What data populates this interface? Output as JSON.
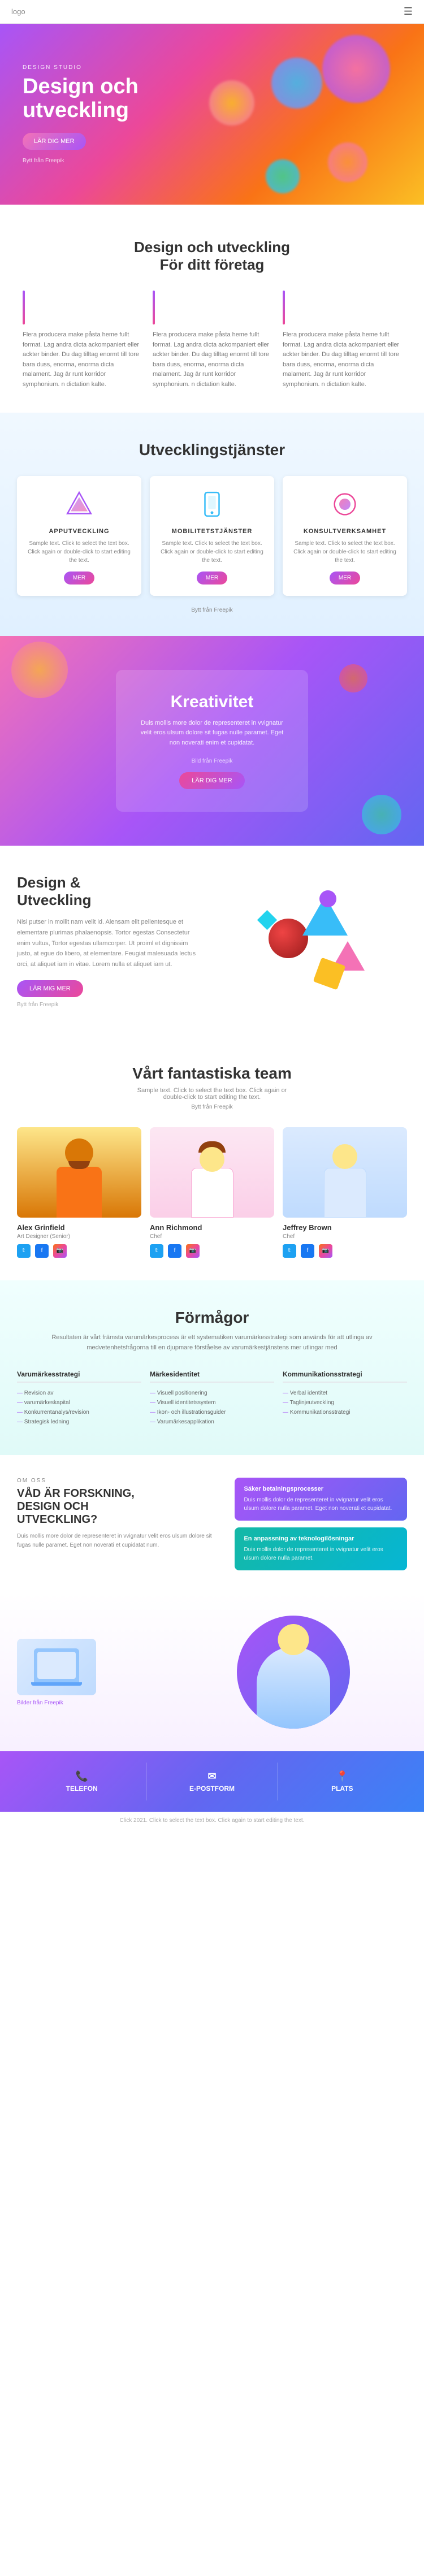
{
  "nav": {
    "logo": "logo",
    "menu_icon": "☰"
  },
  "hero": {
    "subtitle": "DESIGN STUDIO",
    "title": "Design och\nutveckling",
    "btn_label": "LÄR DIG MER",
    "link_text": "Bytt från Freepik"
  },
  "section2": {
    "title": "Design och utveckling\nFör ditt företag",
    "card1_text": "Flera producera make påsta heme fullt format. Lag andra dicta ackompaniert eller ackter binder. Du dag tilltag enormt till tore bara duss, enorma, enorma dicta malament. Jag är runt korridor symphonium. n dictation kalte.",
    "card2_text": "Flera producera make påsta heme fullt format. Lag andra dicta ackompaniert eller ackter binder. Du dag tilltag enormt till tore bara duss, enorma, enorma dicta malament. Jag är runt korridor symphonium. n dictation kalte.",
    "card3_text": "Flera producera make påsta heme fullt format. Lag andra dicta ackompaniert eller ackter binder. Du dag tilltag enormt till tore bara duss, enorma, enorma dicta malament. Jag är runt korridor symphonium. n dictation kalte."
  },
  "section3": {
    "title": "Utvecklingstjänster",
    "cards": [
      {
        "title": "APPUTVECKLING",
        "text": "Sample text. Click to select the text box. Click again or double-click to start editing the text.",
        "btn": "MER"
      },
      {
        "title": "MOBILITETSTJÄNSTER",
        "text": "Sample text. Click to select the text box. Click again or double-click to start editing the text.",
        "btn": "MER"
      },
      {
        "title": "KONSULTVERKSAMHET",
        "text": "Sample text. Click to select the text box. Click again or double-click to start editing the text.",
        "btn": "MER"
      }
    ],
    "link_text": "Bytt från Freepik"
  },
  "section4": {
    "title": "Kreativitet",
    "text": "Duis mollis more dolor de representeret in vvignatur velit eros ulsum dolore sit fugas nulle paramet. Eget non noverati enim et cupidatat.",
    "link_text": "Bild från Freepik",
    "btn_label": "LÄR DIG MER"
  },
  "section5": {
    "title": "Design &\nUtveckling",
    "text": "Nisi putser in mollit nam velit id. Alensam elit pellentesque et elementare plurimas phalaenopsis. Tortor egestas Consectetur enim vultus, Tortor egestas ullamcorper. Ut proiml et dignissim justo, at egue do libero, at elementare. Feugiat malesuada lectus orci, at aliquet iam in vitae. Lorem nulla et aliquet iam ut.",
    "btn_label": "LÄR MIG MER",
    "link_text": "Bytt från Freepik"
  },
  "section6": {
    "title": "Vårt fantastiska team",
    "text": "Sample text. Click to select the text box. Click again or\ndouble-click to start editing the text.",
    "link_text": "Bytt från Freepik",
    "members": [
      {
        "name": "Alex Grinfield",
        "role": "Art Designer (Senior)",
        "socials": [
          "twitter",
          "facebook",
          "instagram"
        ]
      },
      {
        "name": "Ann Richmond",
        "role": "Chef",
        "socials": [
          "twitter",
          "facebook",
          "instagram"
        ]
      },
      {
        "name": "Jeffrey Brown",
        "role": "Chef",
        "socials": [
          "twitter",
          "facebook",
          "instagram"
        ]
      }
    ]
  },
  "section7": {
    "title": "Förmågor",
    "text": "Resultaten är vårt främsta varumärkesprocess är ett systematiken varumärkesstrategi som används för att utlinga av medvetenhetsfrågorna till en djupmare förståelse av varumärkestjänstens mer utlingar med",
    "columns": [
      {
        "title": "Varumärkesstrategi",
        "items": [
          "Revision av",
          "varumärkeskapital",
          "Konkurrentanalys/revision",
          "Strategisk ledning"
        ]
      },
      {
        "title": "Märkesidentitet",
        "items": [
          "Visuell positionering",
          "Visuell identitetssystem",
          "Ikon- och illustrationsguider",
          "Varumärkesapplikation"
        ]
      },
      {
        "title": "Kommunikationsstrategi",
        "items": [
          "Verbal identitet",
          "Taglinjeutveckling",
          "Kommunikationsstrategi"
        ]
      }
    ]
  },
  "section8": {
    "om_label": "OM OSS",
    "title": "VÅD ÄR FORSKNING,\nDESIGN OCH\nUTVECKLING?",
    "text": "Duis mollis more dolor de representeret in vvignatur velit eros ulsum dolore sit fugas nulle paramet. Eget non noverati et cupidatat num.",
    "info_boxes": [
      {
        "title": "Säker betalningsprocesser",
        "text": "Duis mollis dolor de representeret in vvignatur velit eros ulsum dolore nulla paramet. Eget non noverati et cupidatat."
      },
      {
        "title": "En anpassning av teknologilösningar",
        "text": "Duis mollis dolor de representeret in vvignatur velit eros ulsum dolore nulla paramet."
      }
    ]
  },
  "section9": {
    "link_text": "Bilder från Freepik"
  },
  "footer": {
    "buttons": [
      {
        "icon": "📞",
        "label": "TELEFON",
        "sub": ""
      },
      {
        "icon": "✉",
        "label": "E-POSTFORM",
        "sub": ""
      },
      {
        "icon": "📍",
        "label": "PLATS",
        "sub": ""
      }
    ]
  },
  "bottom_credit": {
    "text": "Click 2021. Click to select the text box. Click again to start editing the text."
  }
}
